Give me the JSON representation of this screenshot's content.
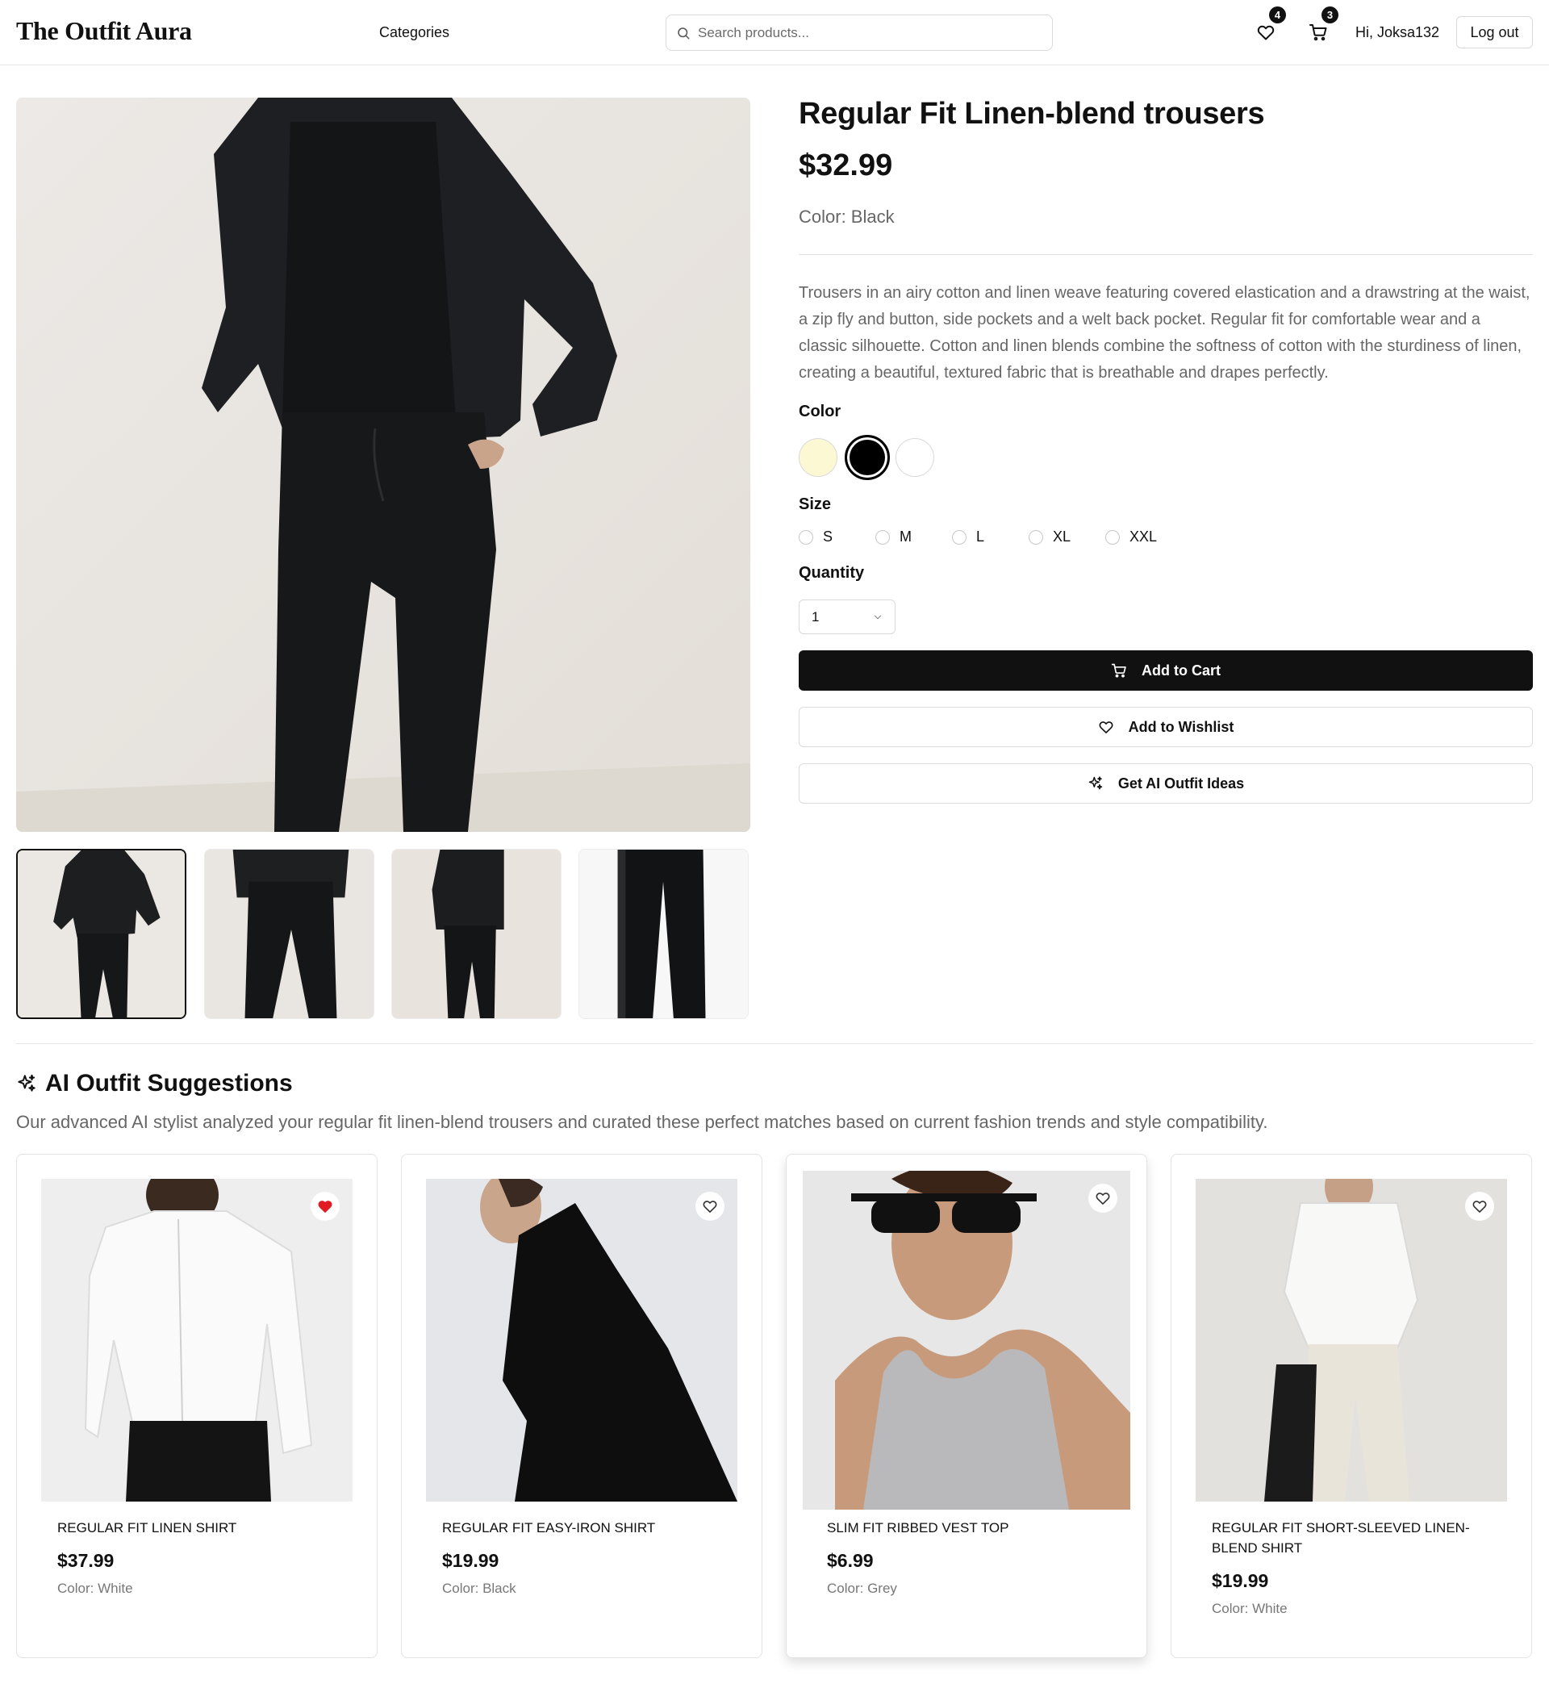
{
  "header": {
    "logo": "The Outfit Aura",
    "categories_label": "Categories",
    "search_placeholder": "Search products...",
    "wishlist_count": "4",
    "cart_count": "3",
    "greeting": "Hi, Joksa132",
    "logout_label": "Log out"
  },
  "product": {
    "title": "Regular Fit Linen-blend trousers",
    "price": "$32.99",
    "color_line": "Color: Black",
    "description": "Trousers in an airy cotton and linen weave featuring covered elastication and a drawstring at the waist, a zip fly and button, side pockets and a welt back pocket. Regular fit for comfortable wear and a classic silhouette. Cotton and linen blends combine the softness of cotton with the sturdiness of linen, creating a beautiful, textured fabric that is breathable and drapes perfectly.",
    "color_label": "Color",
    "colors": [
      {
        "name": "cream",
        "hex": "#fdf8d4",
        "selected": false
      },
      {
        "name": "black",
        "hex": "#000000",
        "selected": true
      },
      {
        "name": "white",
        "hex": "#ffffff",
        "selected": false
      }
    ],
    "size_label": "Size",
    "sizes": [
      "S",
      "M",
      "L",
      "XL",
      "XXL"
    ],
    "quantity_label": "Quantity",
    "quantity_value": "1",
    "add_to_cart_label": "Add to Cart",
    "add_to_wishlist_label": "Add to Wishlist",
    "ai_ideas_label": "Get AI Outfit Ideas",
    "active_thumbnail": 0
  },
  "ai_section": {
    "title": "AI Outfit Suggestions",
    "subtitle": "Our advanced AI stylist analyzed your regular fit linen-blend trousers and curated these perfect matches based on current fashion trends and style compatibility.",
    "items": [
      {
        "name": "Regular Fit Linen shirt",
        "price": "$37.99",
        "color": "Color: White",
        "wishlisted": true
      },
      {
        "name": "Regular Fit Easy-iron shirt",
        "price": "$19.99",
        "color": "Color: Black",
        "wishlisted": false
      },
      {
        "name": "Slim Fit Ribbed vest top",
        "price": "$6.99",
        "color": "Color: Grey",
        "wishlisted": false
      },
      {
        "name": "Regular Fit Short-sleeved linen-blend shirt",
        "price": "$19.99",
        "color": "Color: White",
        "wishlisted": false
      }
    ]
  },
  "icons": {
    "search": "search-icon",
    "wishlist": "heart-icon",
    "cart": "cart-icon",
    "chevron": "chevron-down-icon",
    "ai": "sparkles-icon"
  },
  "colors": {
    "primary": "#111111",
    "muted_text": "#666666",
    "border": "#e2e2e2",
    "wishlist_active": "#e01b24"
  }
}
